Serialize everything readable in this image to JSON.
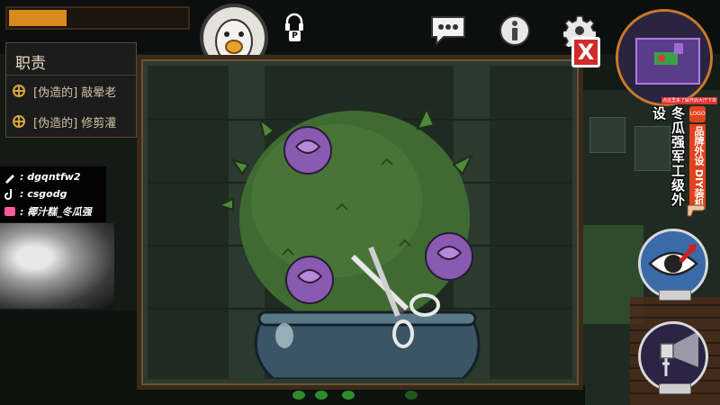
{
  "hud": {
    "progress": 0.32,
    "avatar_icon": "goose-avatar-icon",
    "top_icons": [
      "headset-icon",
      "chat-icon",
      "info-icon",
      "gear-icon"
    ],
    "headset_key": "P"
  },
  "duties": {
    "title": "职责",
    "items": [
      {
        "label": "[伪造的] 敲晕老"
      },
      {
        "label": "[伪造的] 修剪灌"
      }
    ]
  },
  "socials": [
    {
      "icon": "pen-icon",
      "text": ": dgqntfw2"
    },
    {
      "icon": "tiktok-icon",
      "text": ": csgodg"
    },
    {
      "icon": "live-icon",
      "text": ": 椰汁糕_冬瓜强"
    }
  ],
  "minimap": {
    "ad_strip": "点这里来了解开启大厅下单"
  },
  "ad": {
    "main": "冬瓜强军工级外设",
    "side": "品牌外设 DIY装机",
    "badge": "LOGO"
  },
  "modal": {
    "close_label": "X",
    "minigame": "topiary-trim"
  },
  "colors": {
    "accent": "#d98a1e",
    "close": "#d02a2a",
    "bush": "#3f6b32",
    "rose": "#8a5ab0",
    "pot": "#3a5566"
  }
}
